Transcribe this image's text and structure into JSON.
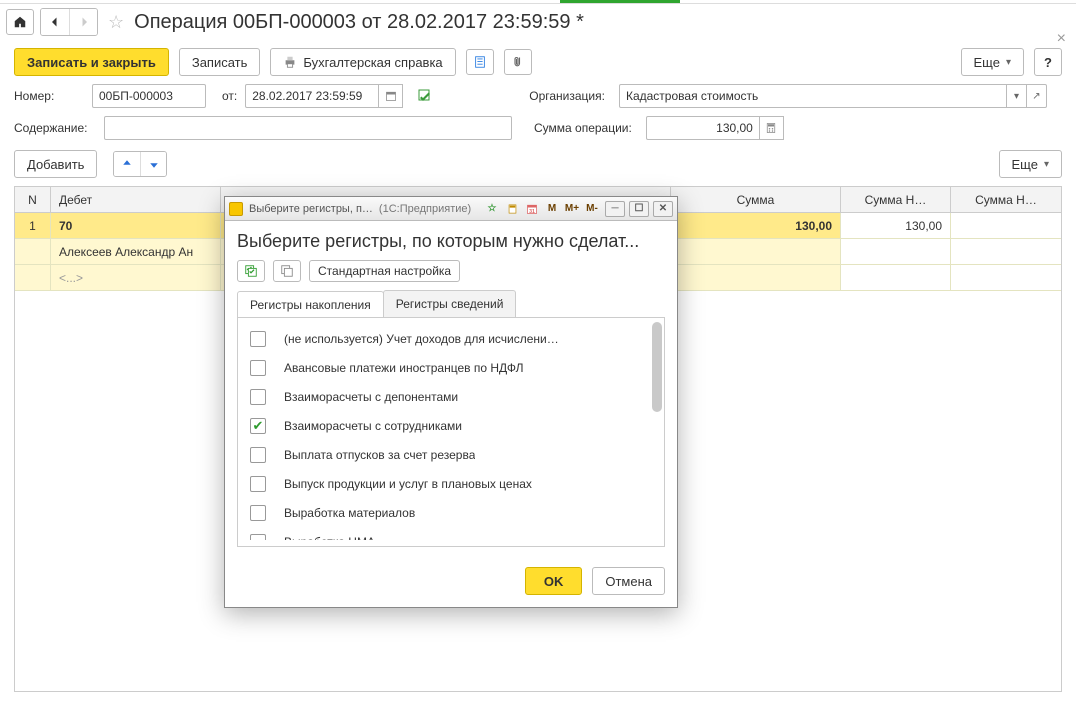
{
  "title": "Операция 00БП-000003 от 28.02.2017 23:59:59 *",
  "toolbar": {
    "save_close": "Записать и закрыть",
    "save": "Записать",
    "accounting_ref": "Бухгалтерская справка",
    "more": "Еще",
    "help": "?"
  },
  "form": {
    "number_label": "Номер:",
    "number_value": "00БП-000003",
    "from_label": "от:",
    "date_value": "28.02.2017 23:59:59",
    "org_label": "Организация:",
    "org_value": "Кадастровая стоимость",
    "content_label": "Содержание:",
    "content_value": "",
    "opsum_label": "Сумма операции:",
    "opsum_value": "130,00"
  },
  "grid_toolbar": {
    "add": "Добавить",
    "more": "Еще"
  },
  "grid": {
    "columns": {
      "n": "N",
      "debet": "Дебет",
      "sum": "Сумма",
      "sumn1": "Сумма Н…",
      "sumn2": "Сумма Н…"
    },
    "row": {
      "n": "1",
      "debet_acc": "70",
      "sum": "130,00",
      "sumn1": "130,00",
      "sumn2": "",
      "sub1": "Алексеев Александр Ан",
      "sub2": "<...>"
    }
  },
  "modal": {
    "titlebar_title": "Выберите регистры, п…",
    "titlebar_app": "(1С:Предприятие)",
    "m": "M",
    "mplus": "M+",
    "mminus": "M-",
    "heading": "Выберите регистры, по которым нужно сделат...",
    "std_setup": "Стандартная настройка",
    "tab1": "Регистры накопления",
    "tab2": "Регистры сведений",
    "items": [
      {
        "checked": false,
        "label": "(не используется) Учет доходов для исчислени…"
      },
      {
        "checked": false,
        "label": "Авансовые платежи иностранцев по НДФЛ"
      },
      {
        "checked": false,
        "label": "Взаиморасчеты с депонентами"
      },
      {
        "checked": true,
        "label": "Взаиморасчеты с сотрудниками"
      },
      {
        "checked": false,
        "label": "Выплата отпусков за счет резерва"
      },
      {
        "checked": false,
        "label": "Выпуск продукции и услуг в плановых ценах"
      },
      {
        "checked": false,
        "label": "Выработка материалов"
      },
      {
        "checked": false,
        "label": "Выработка НМА"
      }
    ],
    "ok": "OK",
    "cancel": "Отмена"
  }
}
